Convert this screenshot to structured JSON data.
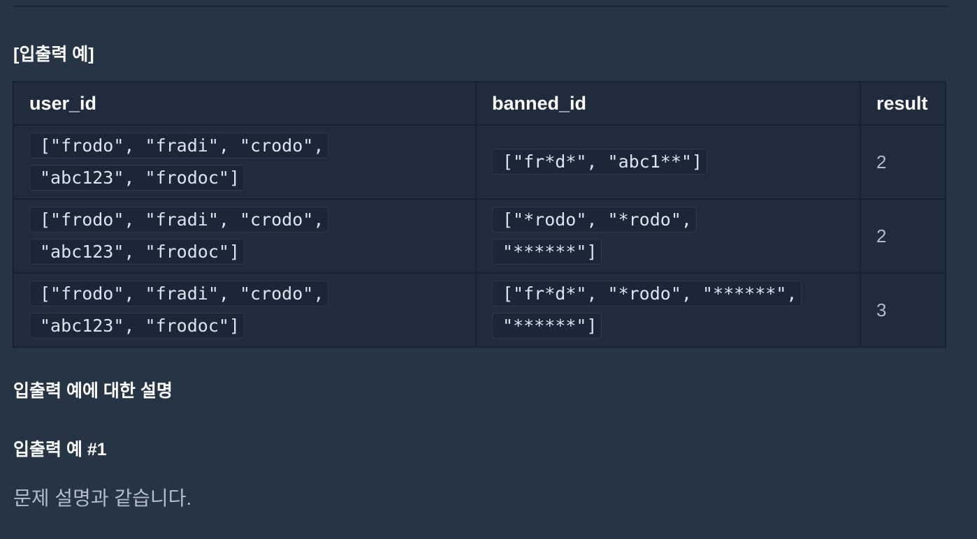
{
  "headings": {
    "io_examples": "[입출력 예]",
    "explanation": "입출력 예에 대한 설명",
    "example_1": "입출력 예 #1"
  },
  "explanation_text": "문제 설명과 같습니다.",
  "table": {
    "columns": [
      "user_id",
      "banned_id",
      "result"
    ],
    "rows": [
      {
        "user_id": "[\"frodo\", \"fradi\", \"crodo\", \"abc123\", \"frodoc\"]",
        "banned_id": "[\"fr*d*\", \"abc1**\"]",
        "result": "2"
      },
      {
        "user_id": "[\"frodo\", \"fradi\", \"crodo\", \"abc123\", \"frodoc\"]",
        "banned_id": "[\"*rodo\", \"*rodo\", \"******\"]",
        "result": "2"
      },
      {
        "user_id": "[\"frodo\", \"fradi\", \"crodo\", \"abc123\", \"frodoc\"]",
        "banned_id": "[\"fr*d*\", \"*rodo\", \"******\", \"******\"]",
        "result": "3"
      }
    ]
  }
}
